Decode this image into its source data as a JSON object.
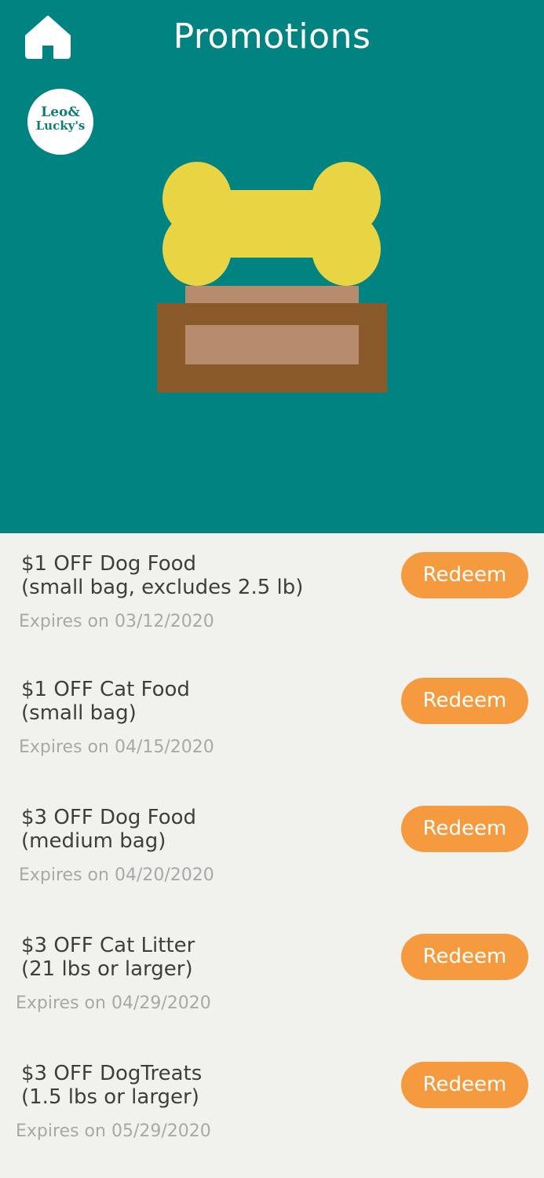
{
  "header": {
    "title": "Promotions",
    "home_icon": "home-icon",
    "background_color": "#018381"
  },
  "logo": {
    "line1": "Leo&",
    "line2": "Lucky's",
    "icon": "leo-luckys-logo"
  },
  "hero_illustration": {
    "icon": "dog-bone-on-pedestal",
    "bone_color": "#e9d543",
    "pedestal_color": "#8a5a2b",
    "pedestal_inset_color": "#b68b6e"
  },
  "promotions": [
    {
      "title_line1": "$1 OFF Dog Food",
      "title_line2": "(small bag, excludes 2.5 lb)",
      "expires": "Expires on 03/12/2020",
      "button_label": "Redeem"
    },
    {
      "title_line1": "$1 OFF Cat Food",
      "title_line2": "(small bag)",
      "expires": "Expires on 04/15/2020",
      "button_label": "Redeem"
    },
    {
      "title_line1": "$3 OFF Dog Food",
      "title_line2": "(medium bag)",
      "expires": "Expires on 04/20/2020",
      "button_label": "Redeem"
    },
    {
      "title_line1": "$3 OFF Cat Litter",
      "title_line2": "(21 lbs or larger)",
      "expires": "Expires on 04/29/2020",
      "button_label": "Redeem"
    },
    {
      "title_line1": "$3 OFF DogTreats",
      "title_line2": "(1.5 lbs or larger)",
      "expires": "Expires on 05/29/2020",
      "button_label": "Redeem"
    }
  ],
  "colors": {
    "accent": "#f59a3f",
    "list_background": "#f1f2ee",
    "text": "#3e3e3e",
    "muted_text": "#a8a8a8"
  }
}
